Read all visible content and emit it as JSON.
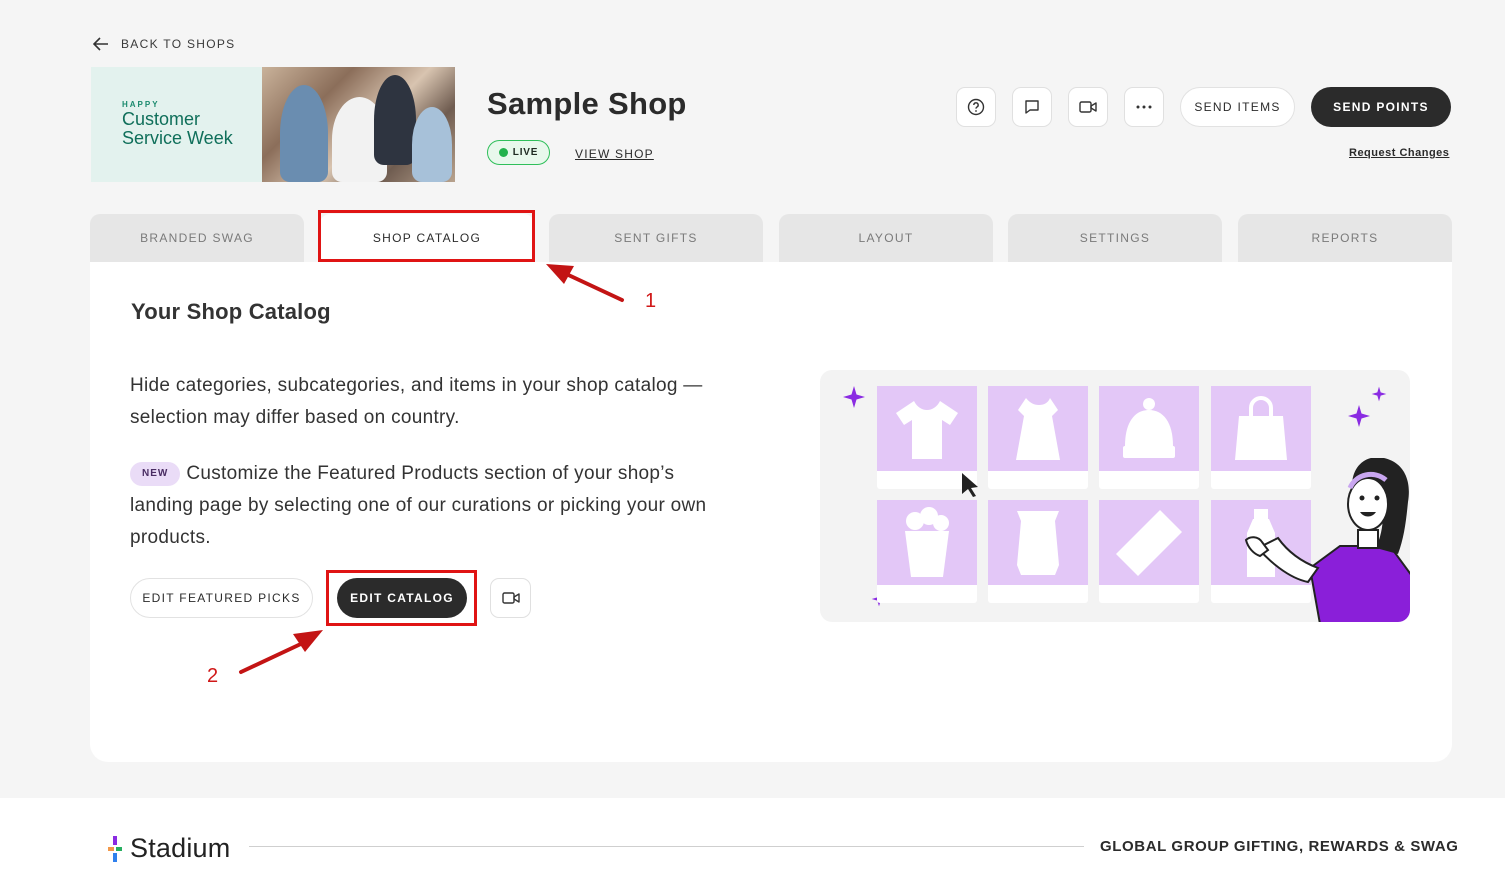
{
  "nav": {
    "back_label": "BACK TO SHOPS"
  },
  "banner": {
    "small": "HAPPY",
    "line1": "Customer",
    "line2": "Service Week"
  },
  "shop": {
    "title": "Sample Shop",
    "status": "LIVE",
    "view_label": "VIEW SHOP"
  },
  "header_actions": {
    "icons": [
      "help-icon",
      "chat-icon",
      "video-icon",
      "more-icon"
    ],
    "send_items": "SEND ITEMS",
    "send_points": "SEND POINTS",
    "request_changes": "Request Changes"
  },
  "tabs": [
    {
      "label": "BRANDED SWAG"
    },
    {
      "label": "SHOP CATALOG",
      "active": true
    },
    {
      "label": "SENT GIFTS"
    },
    {
      "label": "LAYOUT"
    },
    {
      "label": "SETTINGS"
    },
    {
      "label": "REPORTS"
    }
  ],
  "catalog": {
    "title": "Your Shop Catalog",
    "description": "Hide categories, subcategories, and items in your shop catalog —selection may differ based on country.",
    "new_badge": "NEW",
    "featured_text": "Customize the Featured Products section of your shop’s landing page by selecting one of our curations or picking your own products.",
    "edit_featured_label": "EDIT FEATURED PICKS",
    "edit_catalog_label": "EDIT CATALOG"
  },
  "annotations": {
    "step1": "1",
    "step2": "2",
    "color": "#e01414"
  },
  "illustration": {
    "items": [
      "tshirt-icon",
      "dress-icon",
      "beanie-icon",
      "bag-icon",
      "popcorn-icon",
      "snack-bag-icon",
      "candy-bar-icon",
      "bottle-icon"
    ]
  },
  "footer": {
    "brand": "Stadium",
    "tagline": "GLOBAL GROUP GIFTING, REWARDS & SWAG"
  },
  "colors": {
    "dark": "#2b2b2b",
    "accent_purple": "#8a2be2",
    "tile_purple": "#e3c7f7",
    "live_green": "#22b24c"
  }
}
